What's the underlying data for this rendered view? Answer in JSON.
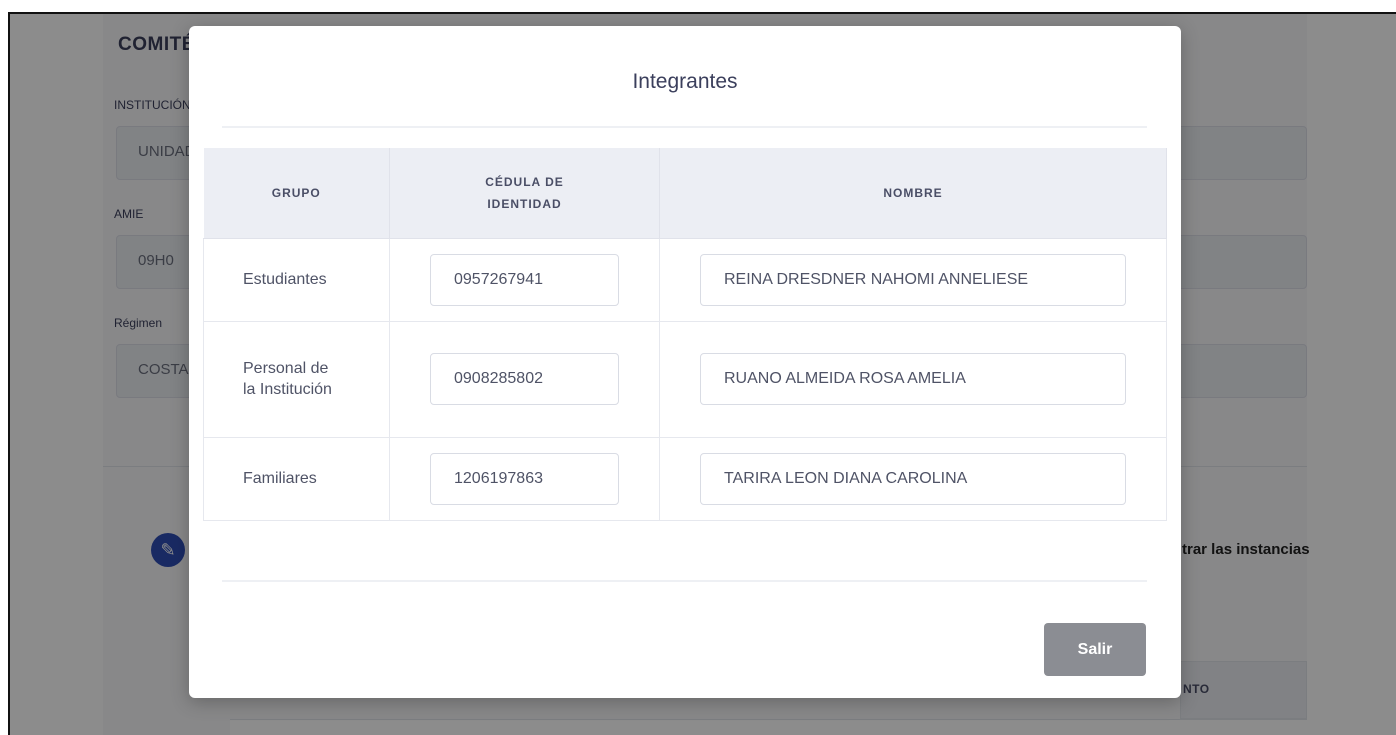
{
  "background": {
    "title": "COMITÉ",
    "fields": [
      {
        "label": "INSTITUCIÓN",
        "value": "UNIDAD"
      },
      {
        "label": "AMIE",
        "value": "09H0"
      },
      {
        "label": "Régimen",
        "value": "COSTA"
      }
    ],
    "side_text": "trar las instancias",
    "table_header_fragment": "NTO"
  },
  "modal": {
    "title": "Integrantes",
    "columns": [
      "GRUPO",
      "CÉDULA DE IDENTIDAD",
      "NOMBRE"
    ],
    "rows": [
      {
        "grupo": "Estudiantes",
        "cedula": "0957267941",
        "nombre": "REINA DRESDNER NAHOMI ANNELIESE"
      },
      {
        "grupo": "Personal de la Institución",
        "cedula": "0908285802",
        "nombre": "RUANO ALMEIDA ROSA AMELIA"
      },
      {
        "grupo": "Familiares",
        "cedula": "1206197863",
        "nombre": "TARIRA LEON DIANA CAROLINA"
      }
    ],
    "exit_label": "Salir"
  },
  "colors": {
    "overlay": "#000000",
    "header_bg": "#eceef4",
    "exit_button": "#8b8d93",
    "edit_icon_bg": "#2f4db5"
  }
}
